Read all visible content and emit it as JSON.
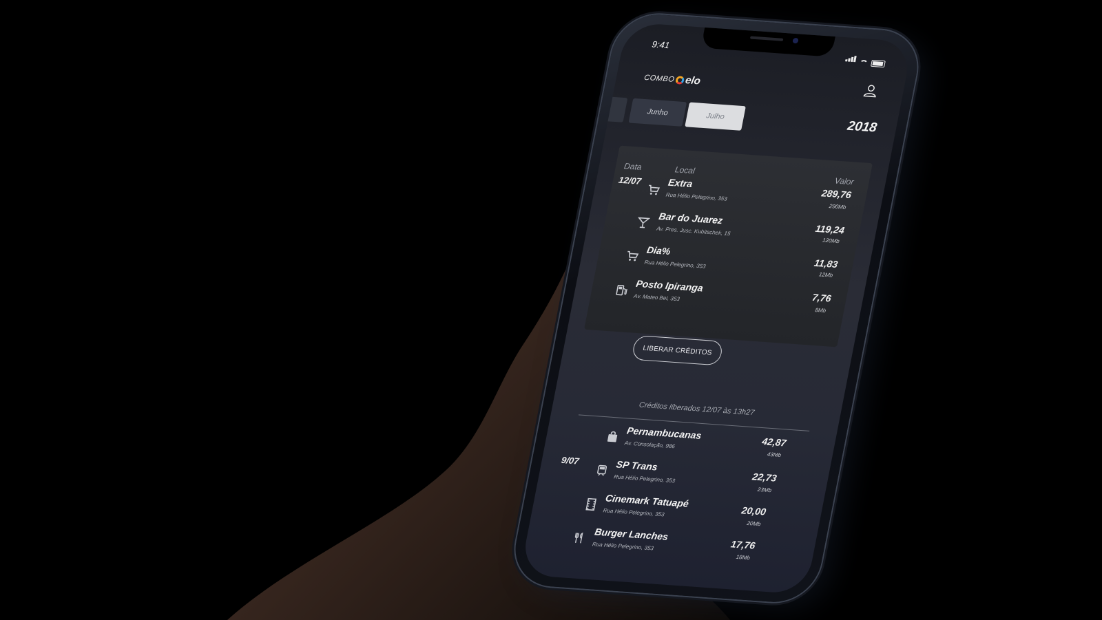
{
  "status_bar": {
    "time": "9:41"
  },
  "brand": {
    "combo": "COMBO",
    "elo": "elo"
  },
  "months": {
    "tabs": [
      {
        "label": "Junho",
        "selected": false
      },
      {
        "label": "Julho",
        "selected": true
      }
    ],
    "year": "2018"
  },
  "pending": {
    "headers": {
      "date": "Data",
      "local": "Local",
      "value": "Valor"
    },
    "date": "12/07",
    "items": [
      {
        "name": "Extra",
        "address": "Rua Hélio Pelegrino, 353",
        "amount": "289,76",
        "data": "290Mb",
        "icon": "cart-icon"
      },
      {
        "name": "Bar do Juarez",
        "address": "Av. Pres. Jusc. Kubitschek, 15",
        "amount": "119,24",
        "data": "120Mb",
        "icon": "cocktail-icon"
      },
      {
        "name": "Dia%",
        "address": "Rua Hélio Pelegrino, 353",
        "amount": "11,83",
        "data": "12Mb",
        "icon": "cart-icon"
      },
      {
        "name": "Posto Ipiranga",
        "address": "Av. Mateo Bei, 353",
        "amount": "7,76",
        "data": "8Mb",
        "icon": "fuel-icon"
      }
    ],
    "button": "LIBERAR CRÉDITOS"
  },
  "released": {
    "note": "Créditos liberados 12/07 às 13h27",
    "date": "9/07",
    "items": [
      {
        "name": "Pernambucanas",
        "address": "Av. Consolação, 986",
        "amount": "42,87",
        "data": "43Mb",
        "icon": "shopping-bag-icon"
      },
      {
        "name": "SP Trans",
        "address": "Rua Hélio Pelegrino, 353",
        "amount": "22,73",
        "data": "23Mb",
        "icon": "train-icon"
      },
      {
        "name": "Cinemark Tatuapé",
        "address": "Rua Hélio Pelegrino, 353",
        "amount": "20,00",
        "data": "20Mb",
        "icon": "film-icon"
      },
      {
        "name": "Burger Lanches",
        "address": "Rua Hélio Pelegrino, 353",
        "amount": "17,76",
        "data": "18Mb",
        "icon": "restaurant-icon"
      }
    ]
  },
  "colors": {
    "accent_yellow": "#f5a623",
    "accent_blue": "#3aa3e3",
    "accent_red": "#e53935",
    "background": "#000000"
  }
}
